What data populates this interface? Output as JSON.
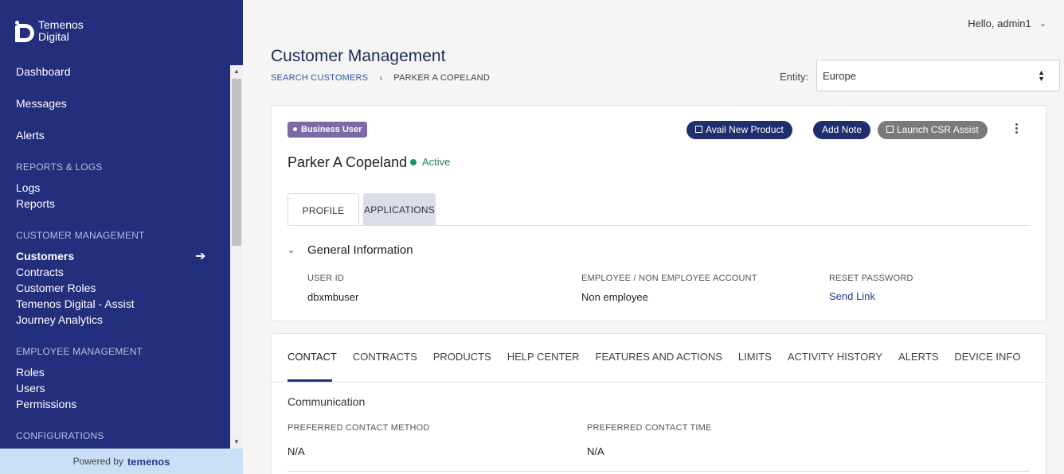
{
  "brand": {
    "line1": "Temenos",
    "line2": "Digital"
  },
  "sidebar": {
    "items": {
      "dashboard": "Dashboard",
      "messages": "Messages",
      "alerts": "Alerts",
      "reports_logs_header": "REPORTS & LOGS",
      "logs": "Logs",
      "reports": "Reports",
      "customer_mgmt_header": "CUSTOMER MANAGEMENT",
      "customers": "Customers",
      "contracts": "Contracts",
      "customer_roles": "Customer Roles",
      "td_assist": "Temenos Digital - Assist",
      "journey_analytics": "Journey Analytics",
      "employee_mgmt_header": "EMPLOYEE MANAGEMENT",
      "roles": "Roles",
      "users": "Users",
      "permissions": "Permissions",
      "configurations_header": "CONFIGURATIONS"
    },
    "active": "Customers",
    "powered_by": "Powered by",
    "powered_brand": "temenos"
  },
  "header": {
    "greeting": "Hello, admin1",
    "title": "Customer Management",
    "breadcrumb": [
      "SEARCH CUSTOMERS",
      "PARKER A COPELAND"
    ],
    "entity_label": "Entity:",
    "entity_value": "Europe"
  },
  "customer": {
    "badge": "Business User",
    "name": "Parker A Copeland",
    "status": "Active",
    "actions": {
      "avail_product": "Avail New Product",
      "add_note": "Add Note",
      "launch_csr": "Launch CSR Assist"
    },
    "tabs": [
      "PROFILE",
      "APPLICATIONS"
    ],
    "general_info": {
      "title": "General Information",
      "fields": [
        {
          "label": "USER ID",
          "value": "dbxmbuser"
        },
        {
          "label": "EMPLOYEE / NON EMPLOYEE ACCOUNT",
          "value": "Non employee"
        },
        {
          "label": "RESET PASSWORD",
          "value": "Send Link"
        }
      ]
    }
  },
  "details": {
    "tabs": [
      "CONTACT",
      "CONTRACTS",
      "PRODUCTS",
      "HELP CENTER",
      "FEATURES AND ACTIONS",
      "LIMITS",
      "ACTIVITY HISTORY",
      "ALERTS",
      "DEVICE INFO"
    ],
    "active_tab": "CONTACT",
    "communication": {
      "title": "Communication",
      "fields": [
        {
          "label": "PREFERRED CONTACT METHOD",
          "value": "N/A"
        },
        {
          "label": "PREFERRED CONTACT TIME",
          "value": "N/A"
        }
      ]
    }
  },
  "colors": {
    "sidebar_bg": "#232e7c",
    "badge": "#7c6aa8",
    "status_active": "#139a63",
    "button_dark": "#1f2e6e",
    "button_disabled": "#7a7a7a"
  }
}
